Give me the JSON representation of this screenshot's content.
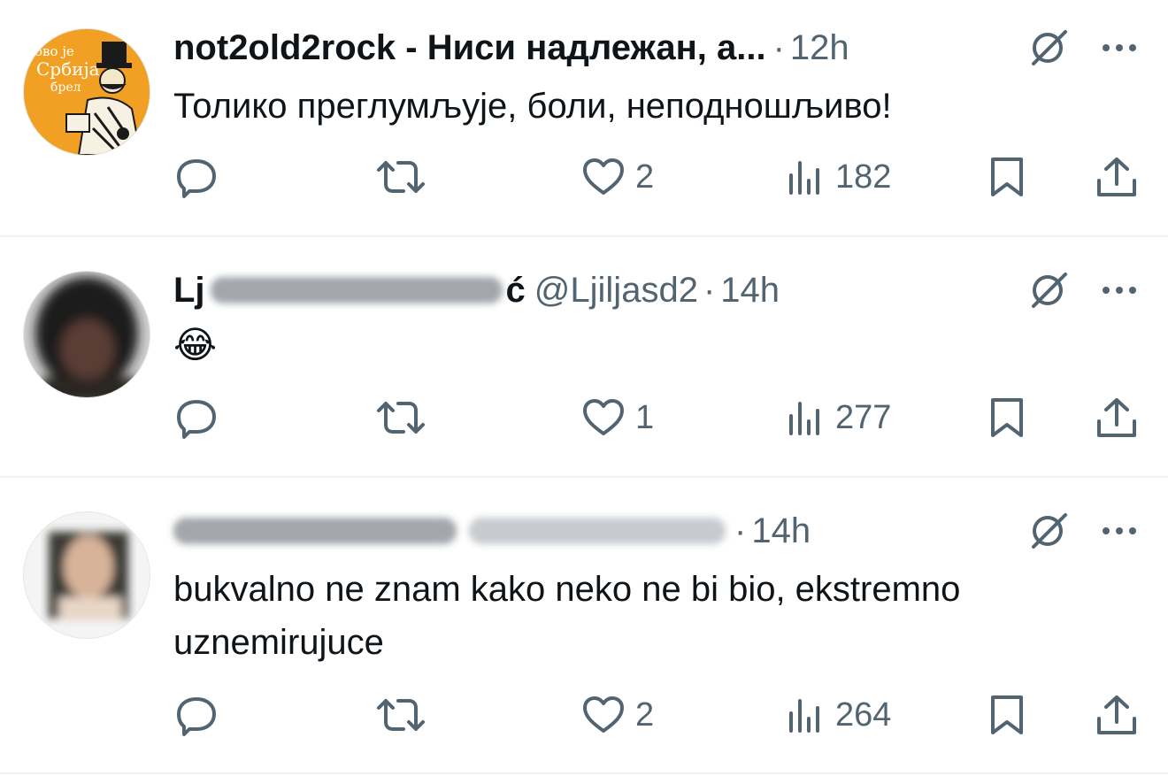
{
  "posts": [
    {
      "author_name": "not2old2rock - Ниси надлежан, а...",
      "handle": "",
      "time": "12h",
      "text": "Толико преглумљује, боли, неподношљиво!",
      "replies": "",
      "reposts": "",
      "likes": "2",
      "views": "182",
      "avatar_text_1": "ово је",
      "avatar_text_2": "Србија",
      "avatar_text_3": "брел"
    },
    {
      "author_name_start": "Lj",
      "author_name_end": "ć",
      "handle": "@Ljiljasd2",
      "time": "14h",
      "text": "😂",
      "replies": "",
      "reposts": "",
      "likes": "1",
      "views": "277"
    },
    {
      "author_name": "",
      "handle": "",
      "time": "14h",
      "text": "bukvalno ne znam kako neko ne bi bio, ekstremno uznemirujuce",
      "replies": "",
      "reposts": "",
      "likes": "2",
      "views": "264"
    }
  ],
  "separator": "·",
  "icons": [
    "reply-icon",
    "repost-icon",
    "like-icon",
    "views-icon",
    "bookmark-icon",
    "share-icon",
    "grok-icon",
    "more-icon"
  ],
  "colors": {
    "text": "#0f1419",
    "muted": "#536471",
    "divider": "#eff3f4",
    "avatar_orange": "#f2a024"
  }
}
